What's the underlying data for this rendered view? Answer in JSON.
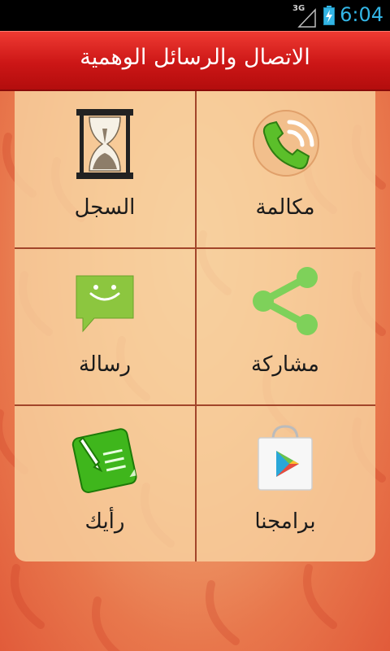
{
  "status_bar": {
    "network": "3G",
    "time": "6:04"
  },
  "header": {
    "title": "الاتصال والرسائل الوهمية"
  },
  "grid": [
    {
      "label": "مكالمة",
      "icon": "phone-call-icon"
    },
    {
      "label": "السجل",
      "icon": "hourglass-icon"
    },
    {
      "label": "مشاركة",
      "icon": "share-icon"
    },
    {
      "label": "رسالة",
      "icon": "message-icon"
    },
    {
      "label": "برامجنا",
      "icon": "play-store-icon"
    },
    {
      "label": "رأيك",
      "icon": "feedback-note-icon"
    }
  ],
  "colors": {
    "header": "#cc1616",
    "accent_green": "#5bbf2a",
    "clock": "#33b5e5"
  }
}
